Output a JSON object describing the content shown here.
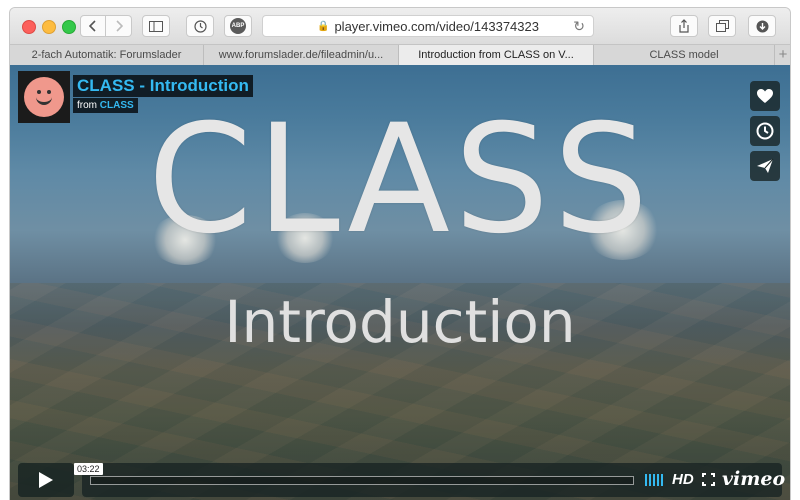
{
  "browser": {
    "address": "player.vimeo.com/video/143374323",
    "abp_label": "ABP",
    "tabs": [
      {
        "label": "2-fach Automatik: Forumslader",
        "active": false
      },
      {
        "label": "www.forumslader.de/fileadmin/u...",
        "active": false
      },
      {
        "label": "Introduction from CLASS on V...",
        "active": true
      },
      {
        "label": "CLASS model",
        "active": false
      }
    ],
    "new_tab_label": "+"
  },
  "video": {
    "overlay_title": "CLASS",
    "overlay_subtitle": "Introduction"
  },
  "player": {
    "title": "CLASS - Introduction",
    "byline_prefix": "from",
    "owner": "CLASS",
    "timecode": "03:22",
    "progress_fraction": 0.0,
    "hd_label": "HD",
    "brand": "vimeo",
    "accent_color": "#34b9f1",
    "icons": [
      "heart-icon",
      "clock-icon",
      "paper-plane-icon",
      "play-icon",
      "volume-icon",
      "fullscreen-icon"
    ]
  }
}
